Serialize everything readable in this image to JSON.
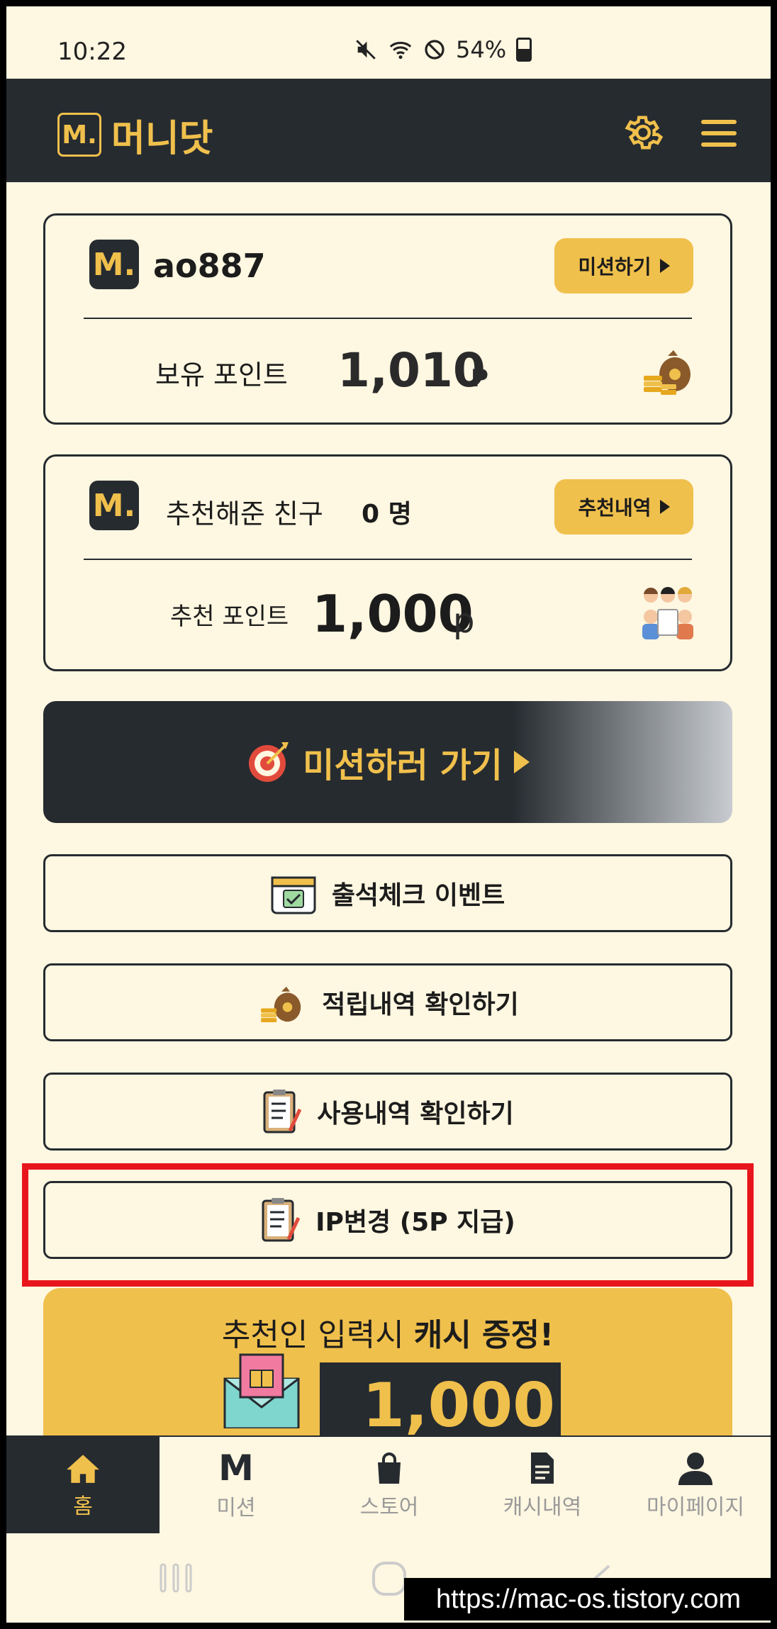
{
  "status_bar": {
    "time": "10:22",
    "battery": "54%"
  },
  "app": {
    "logo": "M.",
    "title": "머니닷"
  },
  "user_card": {
    "username": "ao887",
    "mission_button": "미션하기",
    "points_label": "보유 포인트",
    "points_value": "1,010",
    "points_unit": "P"
  },
  "referral_card": {
    "label": "추천해준 친구",
    "count": "0 명",
    "history_button": "추천내역",
    "points_label": "추천 포인트",
    "points_value": "1,000",
    "points_unit": "p"
  },
  "mission_banner": {
    "label": "미션하러 가기"
  },
  "buttons": {
    "attendance": "출석체크 이벤트",
    "earn_history": "적립내역 확인하기",
    "use_history": "사용내역 확인하기",
    "ip_change": "IP변경 (5P 지급)"
  },
  "promo": {
    "text_normal": "추천인 입력시 ",
    "text_bold": "캐시 증정!",
    "amount": "1,000"
  },
  "bottom_nav": [
    {
      "label": "홈",
      "icon": "home-icon",
      "active": true
    },
    {
      "label": "미션",
      "icon": "m-icon"
    },
    {
      "label": "스토어",
      "icon": "bag-icon"
    },
    {
      "label": "캐시내역",
      "icon": "document-icon"
    },
    {
      "label": "마이페이지",
      "icon": "person-icon"
    }
  ],
  "watermark": "https://mac-os.tistory.com",
  "colors": {
    "dark": "#262b30",
    "accent": "#f0c04c",
    "background": "#fef7e1",
    "highlight": "#e8161c"
  }
}
